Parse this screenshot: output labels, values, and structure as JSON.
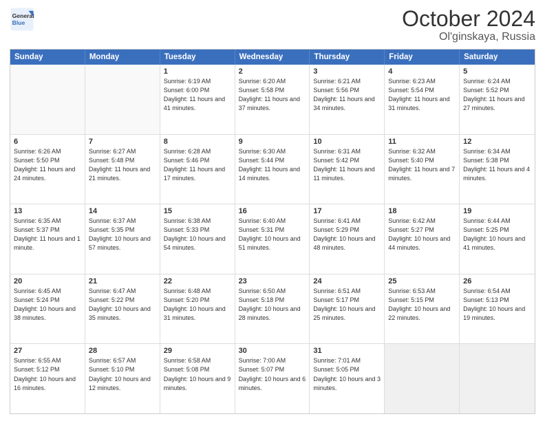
{
  "header": {
    "logo_line1": "General",
    "logo_line2": "Blue",
    "title": "October 2024",
    "location": "Ol'ginskaya, Russia"
  },
  "weekdays": [
    "Sunday",
    "Monday",
    "Tuesday",
    "Wednesday",
    "Thursday",
    "Friday",
    "Saturday"
  ],
  "rows": [
    [
      {
        "day": "",
        "text": ""
      },
      {
        "day": "",
        "text": ""
      },
      {
        "day": "1",
        "text": "Sunrise: 6:19 AM\nSunset: 6:00 PM\nDaylight: 11 hours and 41 minutes."
      },
      {
        "day": "2",
        "text": "Sunrise: 6:20 AM\nSunset: 5:58 PM\nDaylight: 11 hours and 37 minutes."
      },
      {
        "day": "3",
        "text": "Sunrise: 6:21 AM\nSunset: 5:56 PM\nDaylight: 11 hours and 34 minutes."
      },
      {
        "day": "4",
        "text": "Sunrise: 6:23 AM\nSunset: 5:54 PM\nDaylight: 11 hours and 31 minutes."
      },
      {
        "day": "5",
        "text": "Sunrise: 6:24 AM\nSunset: 5:52 PM\nDaylight: 11 hours and 27 minutes."
      }
    ],
    [
      {
        "day": "6",
        "text": "Sunrise: 6:26 AM\nSunset: 5:50 PM\nDaylight: 11 hours and 24 minutes."
      },
      {
        "day": "7",
        "text": "Sunrise: 6:27 AM\nSunset: 5:48 PM\nDaylight: 11 hours and 21 minutes."
      },
      {
        "day": "8",
        "text": "Sunrise: 6:28 AM\nSunset: 5:46 PM\nDaylight: 11 hours and 17 minutes."
      },
      {
        "day": "9",
        "text": "Sunrise: 6:30 AM\nSunset: 5:44 PM\nDaylight: 11 hours and 14 minutes."
      },
      {
        "day": "10",
        "text": "Sunrise: 6:31 AM\nSunset: 5:42 PM\nDaylight: 11 hours and 11 minutes."
      },
      {
        "day": "11",
        "text": "Sunrise: 6:32 AM\nSunset: 5:40 PM\nDaylight: 11 hours and 7 minutes."
      },
      {
        "day": "12",
        "text": "Sunrise: 6:34 AM\nSunset: 5:38 PM\nDaylight: 11 hours and 4 minutes."
      }
    ],
    [
      {
        "day": "13",
        "text": "Sunrise: 6:35 AM\nSunset: 5:37 PM\nDaylight: 11 hours and 1 minute."
      },
      {
        "day": "14",
        "text": "Sunrise: 6:37 AM\nSunset: 5:35 PM\nDaylight: 10 hours and 57 minutes."
      },
      {
        "day": "15",
        "text": "Sunrise: 6:38 AM\nSunset: 5:33 PM\nDaylight: 10 hours and 54 minutes."
      },
      {
        "day": "16",
        "text": "Sunrise: 6:40 AM\nSunset: 5:31 PM\nDaylight: 10 hours and 51 minutes."
      },
      {
        "day": "17",
        "text": "Sunrise: 6:41 AM\nSunset: 5:29 PM\nDaylight: 10 hours and 48 minutes."
      },
      {
        "day": "18",
        "text": "Sunrise: 6:42 AM\nSunset: 5:27 PM\nDaylight: 10 hours and 44 minutes."
      },
      {
        "day": "19",
        "text": "Sunrise: 6:44 AM\nSunset: 5:25 PM\nDaylight: 10 hours and 41 minutes."
      }
    ],
    [
      {
        "day": "20",
        "text": "Sunrise: 6:45 AM\nSunset: 5:24 PM\nDaylight: 10 hours and 38 minutes."
      },
      {
        "day": "21",
        "text": "Sunrise: 6:47 AM\nSunset: 5:22 PM\nDaylight: 10 hours and 35 minutes."
      },
      {
        "day": "22",
        "text": "Sunrise: 6:48 AM\nSunset: 5:20 PM\nDaylight: 10 hours and 31 minutes."
      },
      {
        "day": "23",
        "text": "Sunrise: 6:50 AM\nSunset: 5:18 PM\nDaylight: 10 hours and 28 minutes."
      },
      {
        "day": "24",
        "text": "Sunrise: 6:51 AM\nSunset: 5:17 PM\nDaylight: 10 hours and 25 minutes."
      },
      {
        "day": "25",
        "text": "Sunrise: 6:53 AM\nSunset: 5:15 PM\nDaylight: 10 hours and 22 minutes."
      },
      {
        "day": "26",
        "text": "Sunrise: 6:54 AM\nSunset: 5:13 PM\nDaylight: 10 hours and 19 minutes."
      }
    ],
    [
      {
        "day": "27",
        "text": "Sunrise: 6:55 AM\nSunset: 5:12 PM\nDaylight: 10 hours and 16 minutes."
      },
      {
        "day": "28",
        "text": "Sunrise: 6:57 AM\nSunset: 5:10 PM\nDaylight: 10 hours and 12 minutes."
      },
      {
        "day": "29",
        "text": "Sunrise: 6:58 AM\nSunset: 5:08 PM\nDaylight: 10 hours and 9 minutes."
      },
      {
        "day": "30",
        "text": "Sunrise: 7:00 AM\nSunset: 5:07 PM\nDaylight: 10 hours and 6 minutes."
      },
      {
        "day": "31",
        "text": "Sunrise: 7:01 AM\nSunset: 5:05 PM\nDaylight: 10 hours and 3 minutes."
      },
      {
        "day": "",
        "text": ""
      },
      {
        "day": "",
        "text": ""
      }
    ]
  ]
}
